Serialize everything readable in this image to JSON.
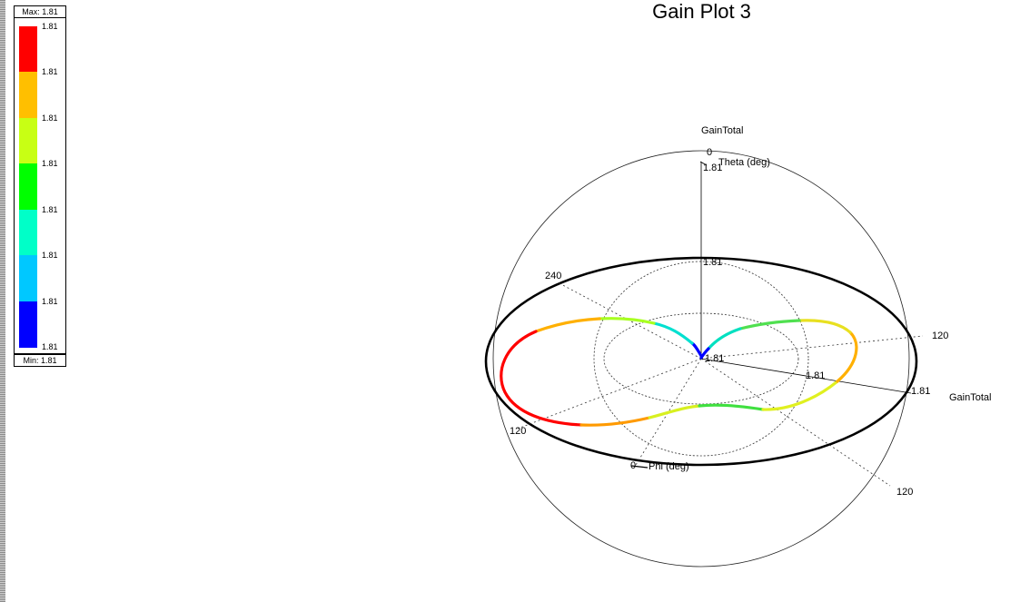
{
  "title": "Gain Plot 3",
  "legend": {
    "max_label": "Max: 1.81",
    "min_label": "Min: 1.81",
    "tick_labels": [
      "1.81",
      "1.81",
      "1.81",
      "1.81",
      "1.81",
      "1.81",
      "1.81",
      "1.81"
    ],
    "colors": [
      "#ff0000",
      "#ffbf00",
      "#c8ff14",
      "#00ff00",
      "#00ffc8",
      "#00c8ff",
      "#0000ff"
    ]
  },
  "chart_data": {
    "type": "3d-polar-radiation-pattern",
    "title": "Gain Plot 3",
    "quantity_label": "GainTotal",
    "theta_axis_label": "Theta (deg)",
    "phi_axis_label": "Phi (deg)",
    "theta_tick_labels": [
      "0"
    ],
    "phi_tick_labels": [
      "240",
      "120",
      "120",
      "0",
      "120"
    ],
    "radial_tick_labels": [
      "1.81",
      "1.81",
      "1.81",
      "1.81",
      "1.81"
    ],
    "gain_min": 1.81,
    "gain_max": 1.81,
    "colormap": "rainbow (blue=min, red=max)",
    "pattern": "figure-eight azimuth cut"
  }
}
